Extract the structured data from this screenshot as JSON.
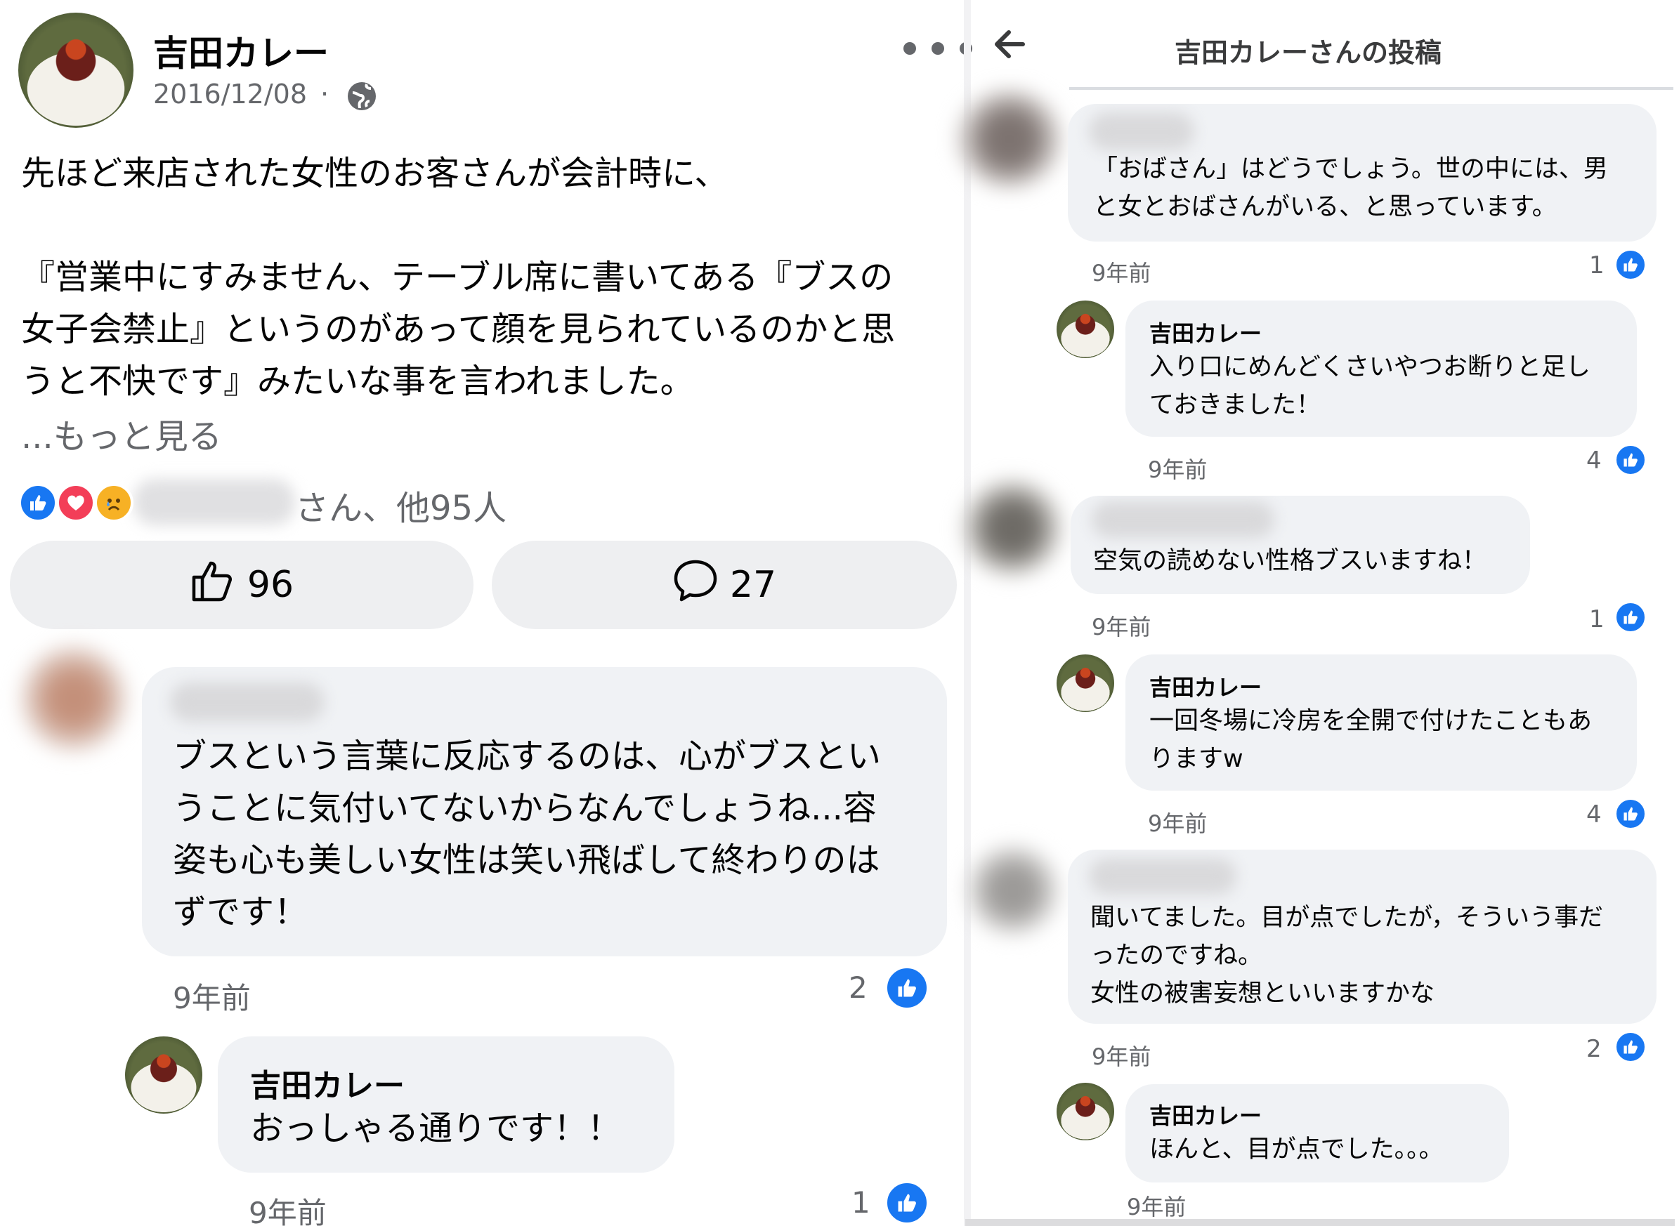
{
  "left": {
    "post": {
      "author": "吉田カレー",
      "date": "2016/12/08",
      "dot": "·",
      "privacy_icon": "globe-icon",
      "menu_icon": "more-horizontal-icon",
      "lines": [
        "先ほど来店された女性のお客さんが会計時に、",
        "『営業中にすみません、テーブル席に書いてある『ブスの",
        "女子会禁止』というのがあって顔を見られているのかと思",
        "うと不快です』みたいな事を言われました。"
      ],
      "see_more": "...もっと見る",
      "reactions_summary": "さん、他95人",
      "like_count": "96",
      "comment_count": "27"
    },
    "comments": [
      {
        "lines": [
          "ブスという言葉に反応するのは、心がブスとい",
          "うことに気付いてないからなんでしょうね...容",
          "姿も心も美しい女性は笑い飛ばして終わりのは",
          "ずです！"
        ],
        "time": "9年前",
        "likes": "2"
      },
      {
        "author": "吉田カレー",
        "text": "おっしゃる通りです！！",
        "time": "9年前",
        "likes": "1"
      }
    ]
  },
  "right": {
    "header": {
      "back_icon": "back-arrow-icon",
      "title": "吉田カレーさんの投稿"
    },
    "comments": [
      {
        "lines": [
          "「おばさん」はどうでしょう。世の中には、男",
          "と女とおばさんがいる、と思っています。"
        ],
        "time": "9年前",
        "likes": "1"
      },
      {
        "author": "吉田カレー",
        "lines": [
          "入り口にめんどくさいやつお断りと足し",
          "ておきました！"
        ],
        "time": "9年前",
        "likes": "4"
      },
      {
        "lines": [
          "空気の読めない性格ブスいますね！"
        ],
        "time": "9年前",
        "likes": "1"
      },
      {
        "author": "吉田カレー",
        "lines": [
          "一回冬場に冷房を全開で付けたこともあ",
          "りますw"
        ],
        "time": "9年前",
        "likes": "4"
      },
      {
        "lines": [
          "聞いてました。目が点でしたが，そういう事だ",
          "ったのですね。",
          "女性の被害妄想といいますかな"
        ],
        "time": "9年前",
        "likes": "2"
      },
      {
        "author": "吉田カレー",
        "lines": [
          "ほんと、目が点でした。。。"
        ],
        "time": "9年前"
      }
    ]
  },
  "colors": {
    "facebook_blue": "#1877f2",
    "bubble_gray": "#f0f2f5",
    "secondary_text": "#65676b"
  }
}
